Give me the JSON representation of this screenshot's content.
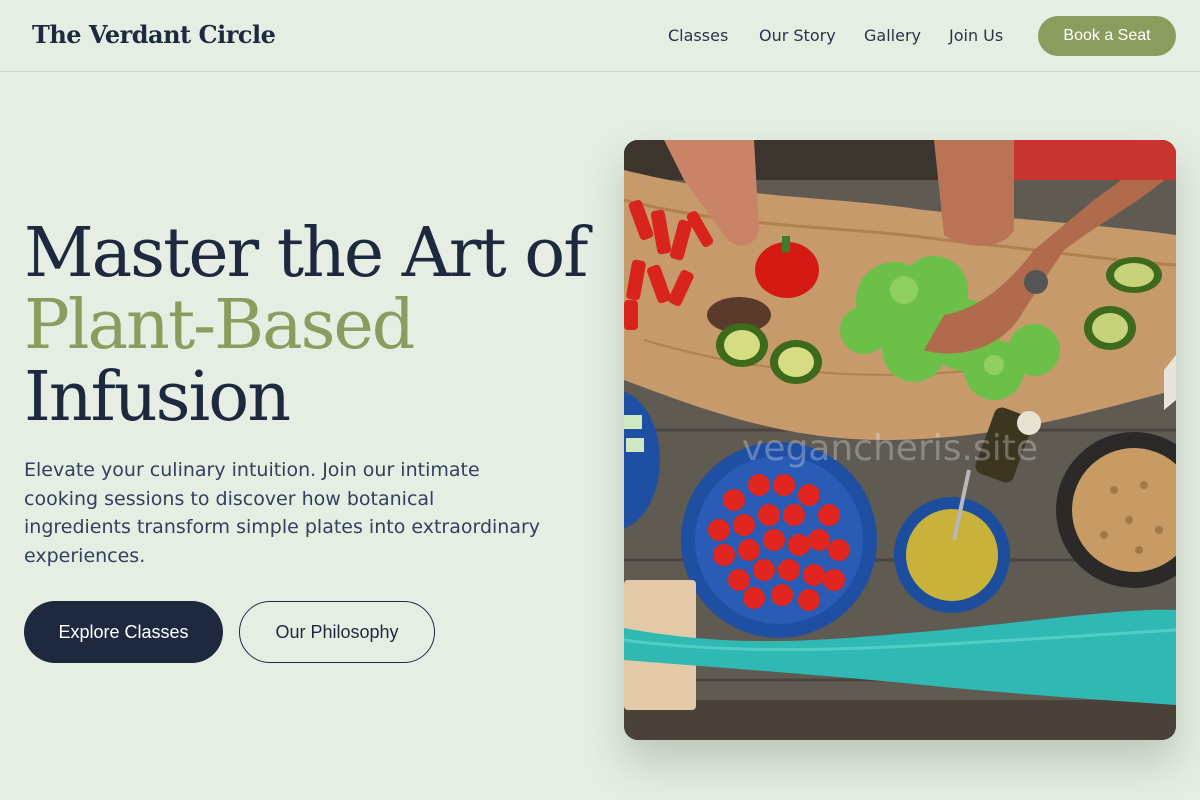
{
  "brand": {
    "name": "The Verdant Circle"
  },
  "nav": {
    "items": [
      "Classes",
      "Our Story",
      "Gallery",
      "Join Us"
    ],
    "cta": "Book a Seat"
  },
  "hero": {
    "headline_line1": "Master the Art of",
    "headline_accent": "Plant-Based",
    "headline_line3": "Infusion",
    "lead": "Elevate your culinary intuition. Join our intimate cooking sessions to discover how botanical ingredients transform simple plates into extraordinary experiences.",
    "primary_button": "Explore Classes",
    "secondary_button": "Our Philosophy"
  },
  "image": {
    "watermark": "vegancheris.site",
    "subject": "overhead view of hands preparing vegetables on a wooden board with tomatoes, avocado, lettuce, peppers and grains"
  },
  "colors": {
    "background": "#e6eee4",
    "navy": "#1e2940",
    "olive_accent": "#8a9c5e"
  }
}
